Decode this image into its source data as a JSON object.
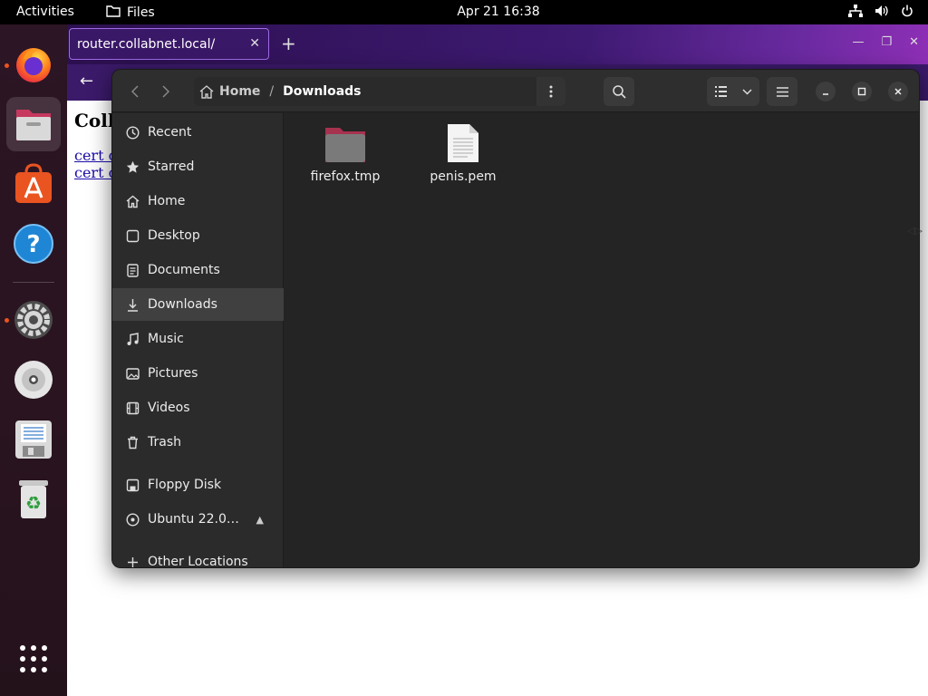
{
  "topbar": {
    "activities": "Activities",
    "app_name": "Files",
    "clock": "Apr 21  16:38"
  },
  "firefox": {
    "tab_title": "router.collabnet.local/",
    "heading": "Coll",
    "links": [
      "cert c",
      "cert c"
    ]
  },
  "nautilus": {
    "path": {
      "home": "Home",
      "separator": "/",
      "current": "Downloads"
    },
    "sidebar": {
      "items": [
        {
          "label": "Recent",
          "icon": "recent-icon"
        },
        {
          "label": "Starred",
          "icon": "star-icon"
        },
        {
          "label": "Home",
          "icon": "home-icon"
        },
        {
          "label": "Desktop",
          "icon": "desktop-icon"
        },
        {
          "label": "Documents",
          "icon": "documents-icon"
        },
        {
          "label": "Downloads",
          "icon": "downloads-icon",
          "selected": true
        },
        {
          "label": "Music",
          "icon": "music-icon"
        },
        {
          "label": "Pictures",
          "icon": "pictures-icon"
        },
        {
          "label": "Videos",
          "icon": "videos-icon"
        },
        {
          "label": "Trash",
          "icon": "trash-icon"
        }
      ],
      "devices": [
        {
          "label": "Floppy Disk",
          "icon": "floppy-icon"
        },
        {
          "label": "Ubuntu 22.0…",
          "icon": "disc-icon",
          "eject": true
        }
      ],
      "other": {
        "label": "Other Locations",
        "icon": "plus-icon"
      }
    },
    "files": [
      {
        "name": "firefox.tmp",
        "type": "folder"
      },
      {
        "name": "penis.pem",
        "type": "text-file"
      }
    ]
  },
  "colors": {
    "accent": "#e95420",
    "folder": "#8e3b53"
  }
}
